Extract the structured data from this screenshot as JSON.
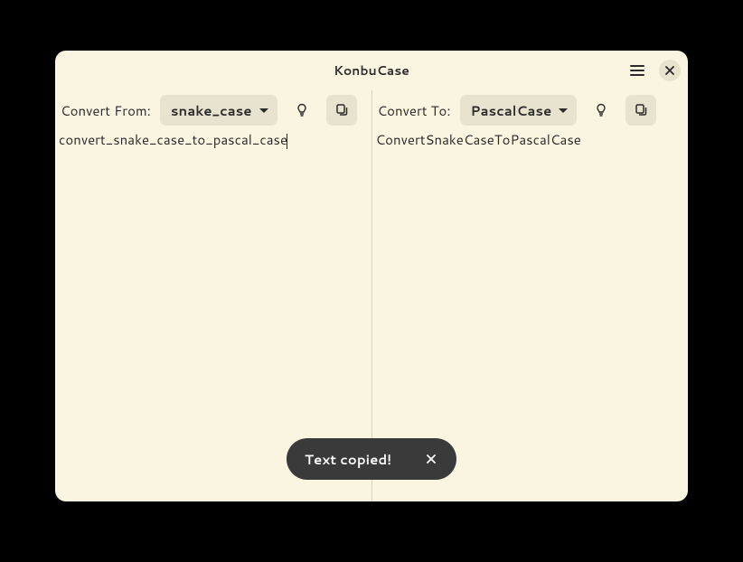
{
  "window": {
    "title": "KonbuCase"
  },
  "left": {
    "label": "Convert From:",
    "dropdown_value": "snake_case",
    "text": "convert_snake_case_to_pascal_case"
  },
  "right": {
    "label": "Convert To:",
    "dropdown_value": "PascalCase",
    "text": "ConvertSnakeCaseToPascalCase"
  },
  "toast": {
    "message": "Text copied!"
  }
}
